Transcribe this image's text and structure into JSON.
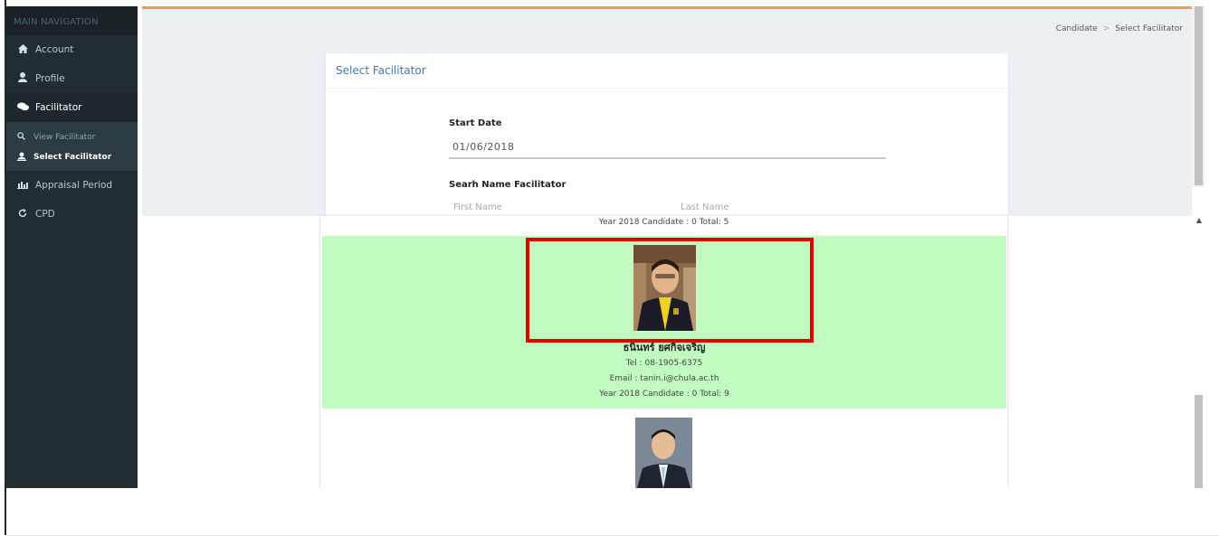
{
  "sidebar": {
    "header": "MAIN NAVIGATION",
    "items": [
      {
        "label": "Account",
        "icon": "home-icon"
      },
      {
        "label": "Profile",
        "icon": "user-icon"
      },
      {
        "label": "Facilitator",
        "icon": "comments-icon"
      },
      {
        "label": "Appraisal Period",
        "icon": "chart-icon"
      },
      {
        "label": "CPD",
        "icon": "refresh-icon"
      }
    ],
    "sub_items": [
      {
        "label": "View Facilitator",
        "icon": "search-icon"
      },
      {
        "label": "Select Facilitator",
        "icon": "user-select-icon"
      }
    ]
  },
  "breadcrumb": {
    "items": [
      "Candidate",
      "Select Facilitator"
    ],
    "separator": ">"
  },
  "panel": {
    "title": "Select Facilitator",
    "start_date_label": "Start Date",
    "start_date_value": "01/06/2018",
    "search_label": "Searh Name Facilitator",
    "first_name_placeholder": "First Name",
    "last_name_placeholder": "Last Name"
  },
  "facilitators": [
    {
      "meta": "Year 2018 Candidate : 0 Total: 5"
    },
    {
      "name": "ธนินทร์ ยศกิจเจริญ",
      "tel": "Tel : 08-1905-6375",
      "email": "Email : tanin.i@chula.ac.th",
      "meta": "Year 2018 Candidate : 0 Total: 9",
      "selected": true
    },
    {}
  ],
  "colors": {
    "sidebar": "#222d32",
    "accent_orange": "#f39c4b",
    "title_blue": "#3c7abf",
    "selected_bg": "#c2fbbf",
    "highlight_red": "#e10000"
  }
}
